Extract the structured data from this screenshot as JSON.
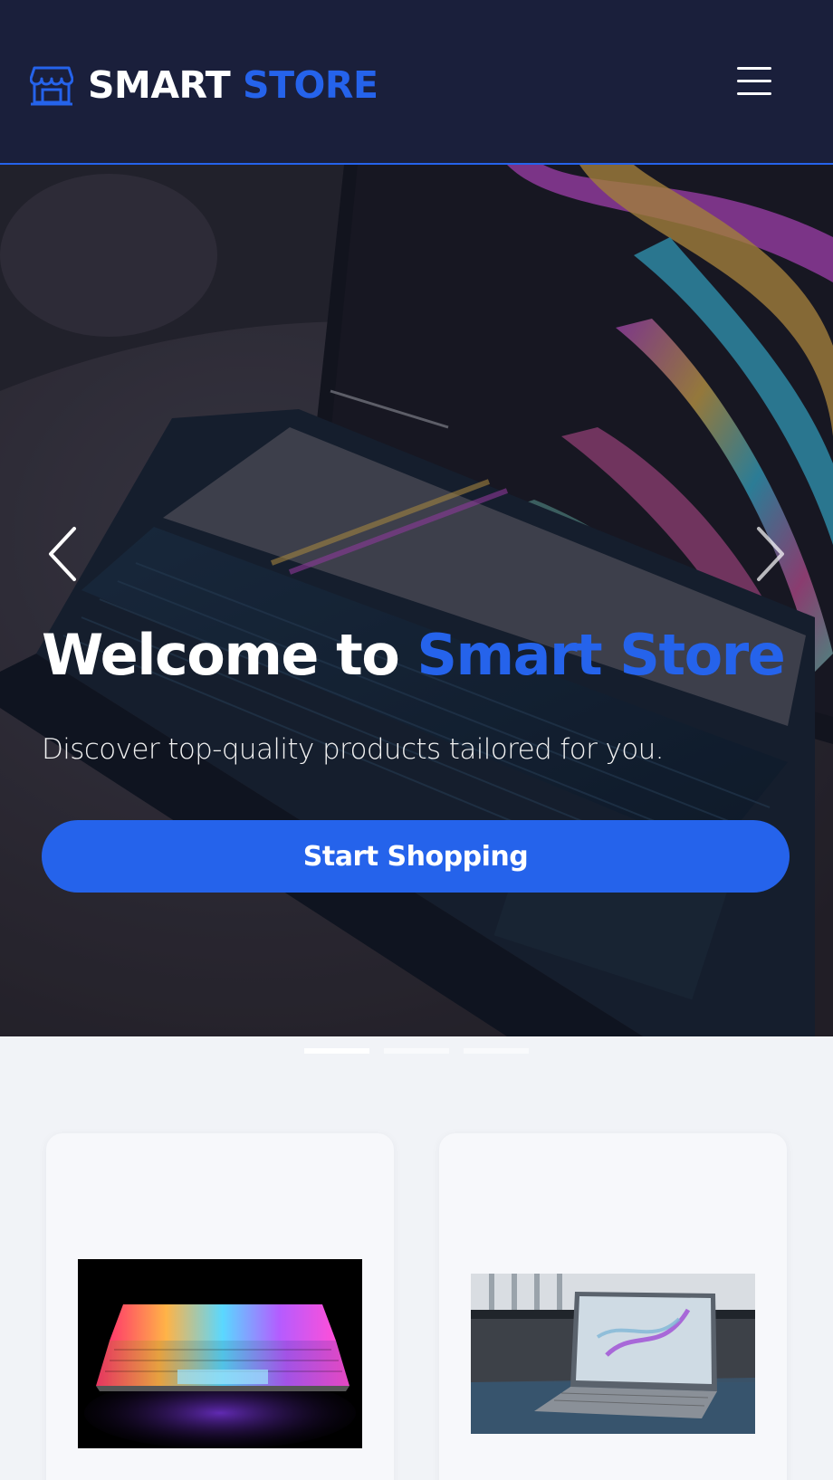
{
  "header": {
    "brand_part1": "SMART",
    "brand_part2": "STORE",
    "brand_icon": "storefront-icon",
    "menu_icon": "hamburger-menu-icon"
  },
  "hero": {
    "title_part1": "Welcome to",
    "title_part2": "Smart Store",
    "subtitle": "Discover top-quality products tailored for you.",
    "cta_label": "Start Shopping",
    "prev_icon": "chevron-left-icon",
    "next_icon": "chevron-right-icon",
    "slide_count": 3,
    "active_slide": 1
  },
  "products": [
    {
      "image": "laptop-glowing-keyboard-photo"
    },
    {
      "image": "laptop-on-windowsill-photo"
    }
  ],
  "colors": {
    "header_bg": "#1a1f3b",
    "accent": "#2563eb",
    "page_bg": "#f1f3f7",
    "card_bg": "#f7f8fb"
  }
}
